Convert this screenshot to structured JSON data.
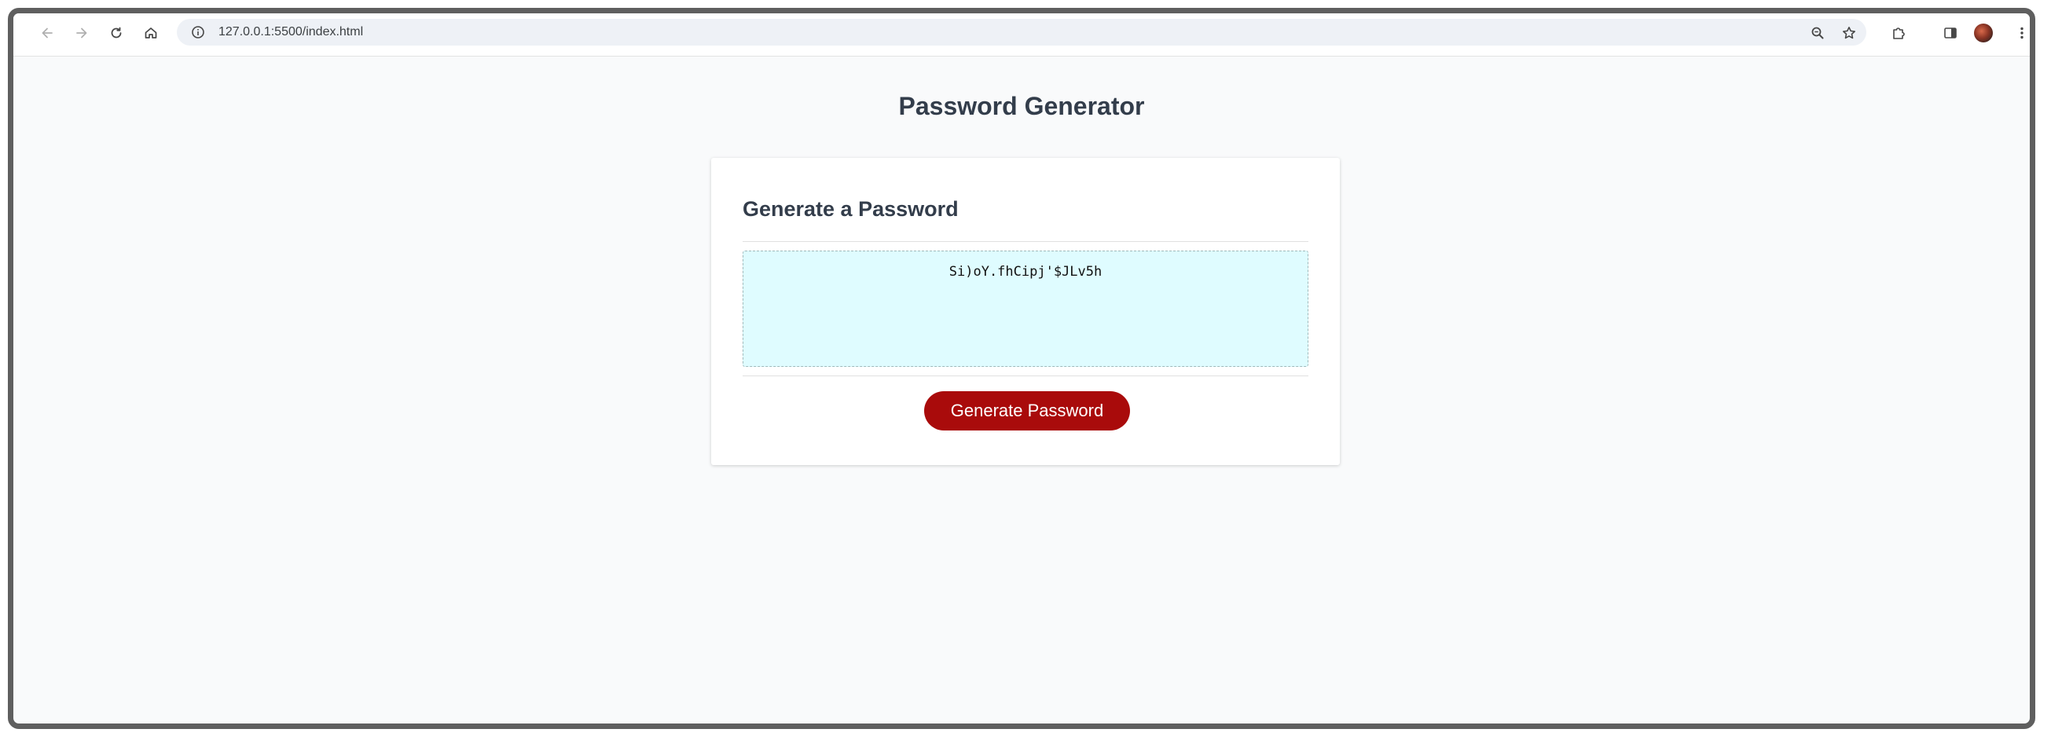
{
  "browser": {
    "url": "127.0.0.1:5500/index.html",
    "icons": [
      "back-icon",
      "forward-icon",
      "reload-icon",
      "home-icon",
      "site-info-icon",
      "zoom-icon",
      "bookmark-star-icon",
      "extensions-icon",
      "side-panel-icon",
      "profile-avatar",
      "more-menu-icon"
    ]
  },
  "page": {
    "title": "Password Generator"
  },
  "card": {
    "title": "Generate a Password",
    "password": "Si)oY.fhCipj'$JLv5h",
    "button_label": "Generate Password"
  },
  "colors": {
    "page_background": "#f9fafb",
    "heading_text": "#333d4b",
    "password_box_background": "#dffcff",
    "button_background": "#a90b0b",
    "button_text": "#ffffff"
  }
}
